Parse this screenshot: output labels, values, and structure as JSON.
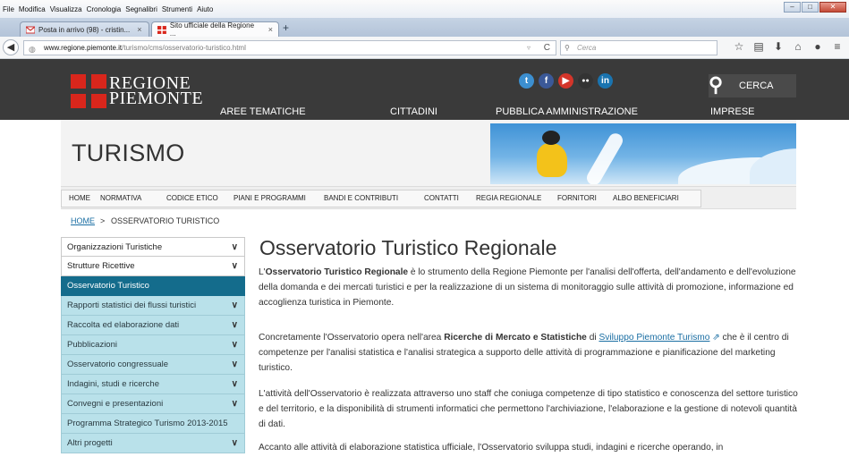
{
  "browser": {
    "menu": [
      "File",
      "Modifica",
      "Visualizza",
      "Cronologia",
      "Segnalibri",
      "Strumenti",
      "Aiuto"
    ],
    "tabs": [
      {
        "label": "Posta in arrivo (98) - cristin...",
        "close": "×"
      },
      {
        "label": "Sito ufficiale della Regione ...",
        "close": "×"
      }
    ],
    "new_tab": "+",
    "url_domain": "www.regione.piemonte.it",
    "url_path": "/turismo/cms/osservatorio-turistico.html",
    "search_placeholder": "Cerca"
  },
  "header": {
    "logo_line1": "REGIONE",
    "logo_line2": "PIEMONTE",
    "nav": [
      "AREE TEMATICHE",
      "CITTADINI",
      "PUBBLICA AMMINISTRAZIONE",
      "IMPRESE"
    ],
    "social": [
      "t",
      "f",
      "▶",
      "●●",
      "in"
    ],
    "search_label": "CERCA"
  },
  "banner": {
    "title": "TURISMO"
  },
  "subnav": [
    "HOME",
    "NORMATIVA",
    "CODICE ETICO",
    "PIANI E PROGRAMMI",
    "BANDI E CONTRIBUTI",
    "CONTATTI",
    "REGIA REGIONALE",
    "FORNITORI",
    "ALBO BENEFICIARI"
  ],
  "breadcrumb": {
    "home": "HOME",
    "sep": ">",
    "current": "OSSERVATORIO TURISTICO"
  },
  "sidebar": {
    "items": [
      {
        "label": "Organizzazioni Turistiche",
        "chevron": "∨"
      },
      {
        "label": "Strutture Ricettive",
        "chevron": "∨"
      },
      {
        "label": "Osservatorio Turistico",
        "chevron": ""
      },
      {
        "label": "Rapporti statistici dei flussi turistici",
        "chevron": "∨"
      },
      {
        "label": "Raccolta ed elaborazione dati",
        "chevron": "∨"
      },
      {
        "label": "Pubblicazioni",
        "chevron": "∨"
      },
      {
        "label": "Osservatorio congressuale",
        "chevron": "∨"
      },
      {
        "label": "Indagini, studi e ricerche",
        "chevron": "∨"
      },
      {
        "label": "Convegni e presentazioni",
        "chevron": "∨"
      },
      {
        "label": "Programma Strategico Turismo 2013-2015",
        "chevron": ""
      },
      {
        "label": "Altri progetti",
        "chevron": "∨"
      }
    ]
  },
  "main": {
    "title": "Osservatorio Turistico Regionale",
    "p1_a": "L'",
    "p1_b": "Osservatorio Turistico Regionale",
    "p1_c": " è lo strumento della Regione Piemonte per l'analisi dell'offerta, dell'andamento e dell'evoluzione della domanda e dei mercati turistici e per la realizzazione di un sistema di monitoraggio sulle attività di promozione, informazione ed accoglienza turistica in Piemonte.",
    "p2_a": "Concretamente l'Osservatorio opera nell'area ",
    "p2_b": "Ricerche di Mercato e Statistiche",
    "p2_c": " di ",
    "p2_link": "Sviluppo Piemonte Turismo",
    "p2_d": " che è il centro di competenze per l'analisi statistica e l'analisi strategica a supporto delle attività di programmazione e pianificazione del marketing turistico.",
    "p3": "L'attività dell'Osservatorio è realizzata attraverso uno staff che coniuga competenze di tipo statistico e conoscenza del settore turistico e del territorio, e la disponibilità di strumenti informatici che permettono l'archiviazione, l'elaborazione e la gestione di notevoli quantità di dati.",
    "p4": "Accanto alle attività di elaborazione statistica ufficiale, l'Osservatorio sviluppa studi, indagini e ricerche operando, in"
  },
  "colors": {
    "header_bg": "#3a3a3a",
    "logo_red": "#d9261c",
    "sidebar_selected": "#146c8c",
    "sidebar_sub": "#b9e1ea",
    "link": "#1a6ea3"
  }
}
